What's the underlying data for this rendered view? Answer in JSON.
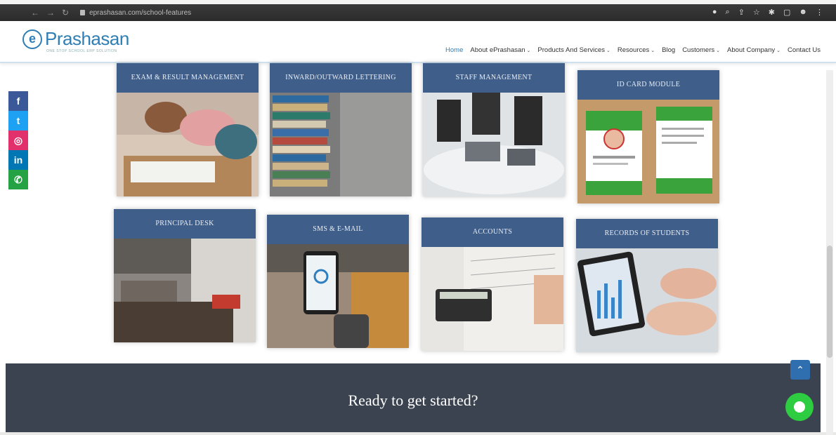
{
  "browser": {
    "url": "eprashasan.com/school-features"
  },
  "site": {
    "logo_name": "Prashasan",
    "logo_mark": "e",
    "tagline": "ONE STOP SCHOOL ERP SOLUTION",
    "menu": [
      {
        "label": "Home",
        "active": true
      },
      {
        "label": "About ePrashasan",
        "caret": true
      },
      {
        "label": "Products And Services",
        "caret": true
      },
      {
        "label": "Resources",
        "caret": true
      },
      {
        "label": "Blog"
      },
      {
        "label": "Customers",
        "caret": true
      },
      {
        "label": "About Company",
        "caret": true
      },
      {
        "label": "Contact Us"
      }
    ]
  },
  "social": {
    "facebook": "f",
    "twitter": "t",
    "instagram": "◎",
    "linkedin": "in",
    "whatsapp": "✆"
  },
  "features": [
    {
      "title": "EXAM & RESULT MANAGEMENT"
    },
    {
      "title": "INWARD/OUTWARD LETTERING"
    },
    {
      "title": "STAFF MANAGEMENT"
    },
    {
      "title": "ID CARD MODULE"
    },
    {
      "title": "PRINCIPAL DESK"
    },
    {
      "title": "SMS & E-MAIL"
    },
    {
      "title": "ACCOUNTS"
    },
    {
      "title": "RECORDS OF STUDENTS"
    }
  ],
  "cta": {
    "text": "Ready to get started?"
  },
  "colors": {
    "brand": "#2f7fb5",
    "card_header": "#3f5f8a",
    "cta_bg": "#3b4350",
    "chat": "#2ecc40"
  }
}
